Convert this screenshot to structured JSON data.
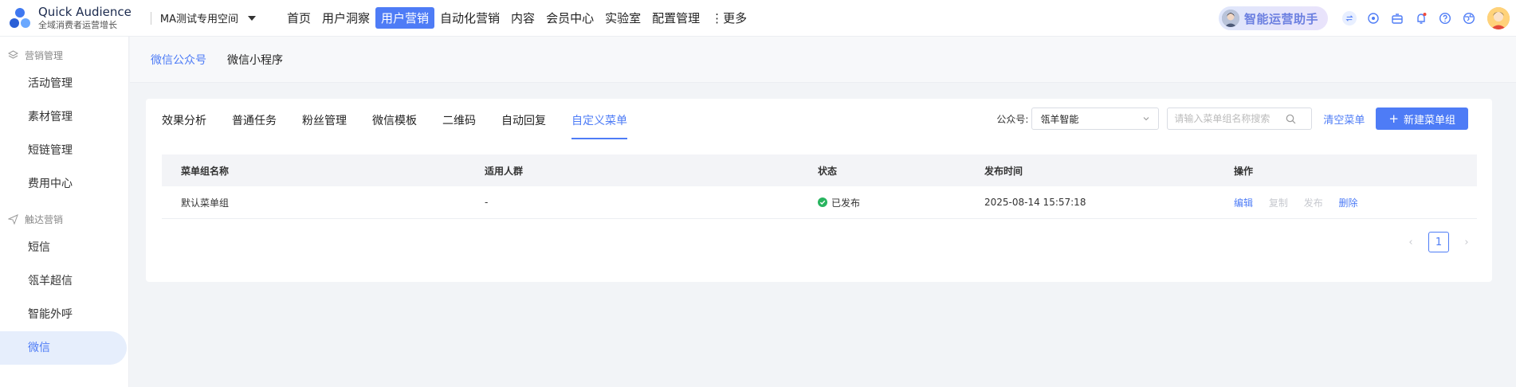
{
  "brand": {
    "title": "Quick Audience",
    "subtitle": "全域消费者运营增长"
  },
  "workspace": "MA测试专用空间",
  "nav": [
    {
      "label": "首页"
    },
    {
      "label": "用户洞察"
    },
    {
      "label": "用户营销",
      "active": true
    },
    {
      "label": "自动化营销"
    },
    {
      "label": "内容"
    },
    {
      "label": "会员中心"
    },
    {
      "label": "实验室"
    },
    {
      "label": "配置管理"
    },
    {
      "label": "⋮更多"
    }
  ],
  "assistant": {
    "label": "智能运营助手"
  },
  "header_icons": [
    "switch-icon",
    "settings-icon",
    "gift-icon",
    "bell-icon",
    "help-icon",
    "globe-icon"
  ],
  "sidebar": {
    "groups": [
      {
        "label": "营销管理",
        "icon": "layers-icon",
        "items": [
          "活动管理",
          "素材管理",
          "短链管理",
          "费用中心"
        ]
      },
      {
        "label": "触达营销",
        "icon": "send-icon",
        "items": [
          "短信",
          "瓴羊超信",
          "智能外呼",
          "微信"
        ]
      }
    ],
    "active_item": "微信"
  },
  "subtabs": [
    {
      "label": "微信公众号",
      "active": true
    },
    {
      "label": "微信小程序"
    }
  ],
  "tabs": [
    {
      "label": "效果分析"
    },
    {
      "label": "普通任务"
    },
    {
      "label": "粉丝管理"
    },
    {
      "label": "微信模板"
    },
    {
      "label": "二维码"
    },
    {
      "label": "自动回复"
    },
    {
      "label": "自定义菜单",
      "active": true
    }
  ],
  "toolbar": {
    "account_label": "公众号:",
    "account_value": "瓴羊智能",
    "search_placeholder": "请输入菜单组名称搜索",
    "clear_label": "清空菜单",
    "new_label": "新建菜单组"
  },
  "table": {
    "columns": [
      "菜单组名称",
      "适用人群",
      "状态",
      "发布时间",
      "操作"
    ],
    "rows": [
      {
        "name": "默认菜单组",
        "audience": "-",
        "status": "已发布",
        "published_at": "2025-08-14 15:57:18",
        "actions": [
          {
            "label": "编辑",
            "enabled": true
          },
          {
            "label": "复制",
            "enabled": false
          },
          {
            "label": "发布",
            "enabled": false
          },
          {
            "label": "删除",
            "enabled": true
          }
        ]
      }
    ]
  },
  "pagination": {
    "current": "1",
    "prev": "‹",
    "next": "›"
  },
  "colors": {
    "primary": "#4e7cf6",
    "success": "#28b45f",
    "disabled": "#c7c9cf"
  }
}
